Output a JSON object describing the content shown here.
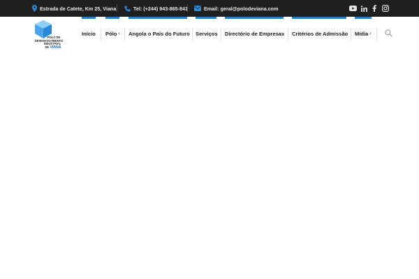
{
  "topbar": {
    "address": "Estrada de Catete, Km 25, Viana",
    "phone": "Tel: (+244) 943-865-841",
    "email": "Email: geral@polodeviana.com",
    "icons": [
      "map-pin-icon",
      "phone-icon",
      "envelope-icon"
    ],
    "social": [
      "youtube-icon",
      "linkedin-icon",
      "facebook-icon",
      "instagram-icon"
    ]
  },
  "logo": {
    "line1": "PÓLO DE",
    "line2": "DESENVOLVIMENTO",
    "line3": "INDUSTRIAL",
    "line4_de": "DE",
    "line4_name": "VIANA"
  },
  "nav": {
    "items": [
      {
        "label": "Início",
        "has_submenu": false
      },
      {
        "label": "Pólo",
        "has_submenu": true
      },
      {
        "label": "Angola o País do Futuro",
        "has_submenu": false
      },
      {
        "label": "Serviços",
        "has_submenu": false
      },
      {
        "label": "Directório de Empresas",
        "has_submenu": false
      },
      {
        "label": "Critérios de Admissão",
        "has_submenu": false
      },
      {
        "label": "Mídia",
        "has_submenu": true
      }
    ],
    "submenu_glyph": "›",
    "search_icon": "search-icon"
  },
  "colors": {
    "topbar_bg": "#1f1f1f",
    "accent": "#1f7fd0",
    "nav_text": "#1a1a1a",
    "page_bg": "#ffffff"
  }
}
